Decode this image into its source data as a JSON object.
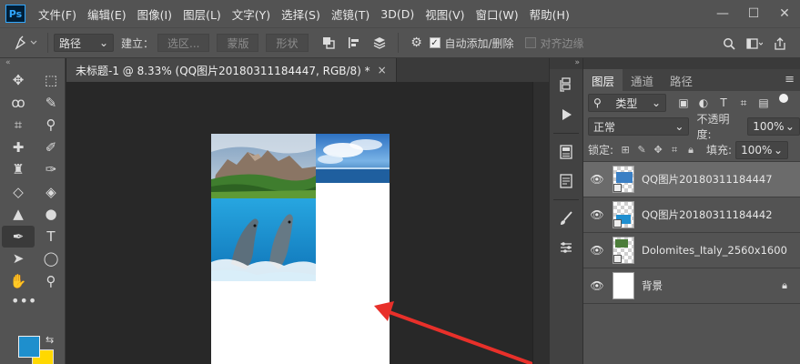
{
  "app": {
    "logo": "Ps"
  },
  "menu": [
    "文件(F)",
    "编辑(E)",
    "图像(I)",
    "图层(L)",
    "文字(Y)",
    "选择(S)",
    "滤镜(T)",
    "3D(D)",
    "视图(V)",
    "窗口(W)",
    "帮助(H)"
  ],
  "window_controls": {
    "minimize": "—",
    "maximize": "☐",
    "close": "✕"
  },
  "options": {
    "path_mode": "路径",
    "make_label": "建立：",
    "selection_btn": "选区...",
    "mask_btn": "蒙版",
    "shape_btn": "形状",
    "auto_add_delete": {
      "label": "自动添加/删除",
      "checked": true
    },
    "align_edges": {
      "label": "对齐边缘",
      "checked": false
    }
  },
  "document": {
    "tab_title": "未标题-1 @ 8.33% (QQ图片20180311184447, RGB/8) *",
    "tab_close": "×"
  },
  "tools": [
    {
      "name": "move-tool",
      "glyph": "✥"
    },
    {
      "name": "marquee-tool",
      "glyph": "⬚"
    },
    {
      "name": "lasso-tool",
      "glyph": "ꝏ"
    },
    {
      "name": "quick-select-tool",
      "glyph": "✎"
    },
    {
      "name": "crop-tool",
      "glyph": "⌗"
    },
    {
      "name": "eyedropper-tool",
      "glyph": "⚲"
    },
    {
      "name": "healing-brush-tool",
      "glyph": "✚"
    },
    {
      "name": "brush-tool",
      "glyph": "✐"
    },
    {
      "name": "clone-stamp-tool",
      "glyph": "♜"
    },
    {
      "name": "history-brush-tool",
      "glyph": "✑"
    },
    {
      "name": "eraser-tool",
      "glyph": "◇"
    },
    {
      "name": "paint-bucket-tool",
      "glyph": "◈"
    },
    {
      "name": "blur-tool",
      "glyph": "▲"
    },
    {
      "name": "dodge-tool",
      "glyph": "●"
    },
    {
      "name": "pen-tool",
      "glyph": "✒",
      "active": true
    },
    {
      "name": "type-tool",
      "glyph": "T"
    },
    {
      "name": "path-select-tool",
      "glyph": "➤"
    },
    {
      "name": "ellipse-tool",
      "glyph": "◯"
    },
    {
      "name": "hand-tool",
      "glyph": "✋"
    },
    {
      "name": "zoom-tool",
      "glyph": "⚲"
    }
  ],
  "toolbar_more": "•••",
  "colors": {
    "foreground": "#1e8fcd",
    "background": "#ffd800",
    "arrow": "#e8302a"
  },
  "panel": {
    "tabs": [
      "图层",
      "通道",
      "路径"
    ],
    "filter_kind": "类型",
    "blend_mode": "正常",
    "opacity_label": "不透明度:",
    "opacity_value": "100%",
    "lock_label": "锁定:",
    "fill_label": "填充:",
    "fill_value": "100%"
  },
  "layers": [
    {
      "name": "QQ图片20180311184447",
      "selected": true
    },
    {
      "name": "QQ图片20180311184442",
      "selected": false
    },
    {
      "name": "Dolomites_Italy_2560x1600",
      "selected": false
    },
    {
      "name": "背景",
      "selected": false,
      "locked": true
    }
  ]
}
